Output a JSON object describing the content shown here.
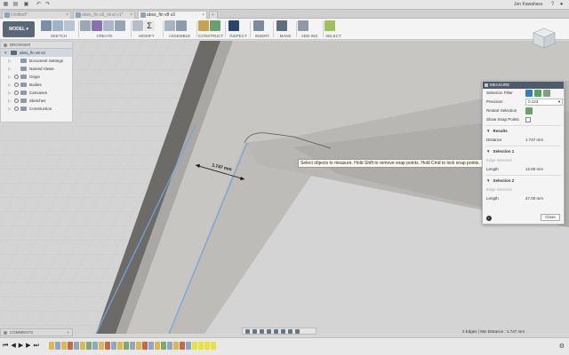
{
  "app": {
    "user_name": "Jon Kawahara"
  },
  "tabs": [
    {
      "label": "Untitled*",
      "active": false
    },
    {
      "label": "abss_fin v6_mod v1*",
      "active": false
    },
    {
      "label": "abss_fin v8 v3",
      "active": true
    }
  ],
  "toolbar": {
    "workspace": "MODEL",
    "groups": [
      "SKETCH",
      "CREATE",
      "MODIFY",
      "ASSEMBLE",
      "CONSTRUCT",
      "INSPECT",
      "INSERT",
      "MAKE",
      "ADD-INS",
      "SELECT"
    ]
  },
  "browser": {
    "title": "BROWSER",
    "root": "abss_fin v8 v3",
    "items": [
      "Document Settings",
      "Named Views",
      "Origin",
      "Bodies",
      "Canvases",
      "Sketches",
      "Construction"
    ]
  },
  "viewport": {
    "dimension": "1.747 mm",
    "tooltip": "Select objects to measure. Hold Shift to remove snap points. Hold Cmd to lock snap points."
  },
  "measure": {
    "title": "MEASURE",
    "selection_filter_label": "Selection Filter",
    "precision_label": "Precision",
    "precision_value": "0.123",
    "restart_selection_label": "Restart Selection",
    "show_snap_points_label": "Show Snap Points",
    "results_title": "Results",
    "distance_label": "Distance",
    "distance_value": "1.747 mm",
    "selection1_title": "Selection 1",
    "selection1_type": "Edge selected",
    "selection1_length_label": "Length",
    "selection1_length_value": "12.00 mm",
    "selection2_title": "Selection 2",
    "selection2_type": "Edge selected",
    "selection2_length_label": "Length",
    "selection2_length_value": "47.00 mm",
    "close_label": "Close"
  },
  "comments": {
    "title": "COMMENTS"
  },
  "status": {
    "text": "2 Edges | Min Distance : 1.747 mm"
  },
  "colors": {
    "accent": "#26476e",
    "panel_header": "#4d5b6b",
    "selection_edge": "#6fa8dc"
  }
}
